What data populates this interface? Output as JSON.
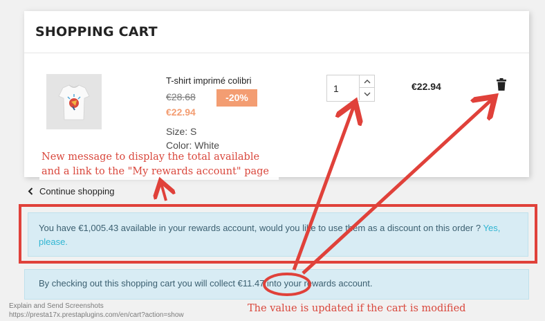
{
  "cart": {
    "title": "SHOPPING CART",
    "item": {
      "name": "T-shirt imprimé colibri",
      "old_price": "€28.68",
      "discount": "-20%",
      "new_price": "€22.94",
      "size": "Size: S",
      "color": "Color: White",
      "quantity": "1",
      "line_total": "€22.94"
    }
  },
  "continue_shopping": "Continue shopping",
  "rewards": {
    "available_text": "You have €1,005.43 available in your rewards account, would you like to use them as a discount on this order ?",
    "use_link": "Yes, please.",
    "earn_prefix": "By checking out this shopping cart you will collect",
    "earn_amount": "€11.47",
    "earn_suffix": "into your rewards account."
  },
  "annotations": {
    "note_1": "New message to display the total available and a link to the \"My rewards account\" page",
    "note_2": "The value is updated if the cart is modified"
  },
  "watermark": {
    "line1": "Explain and Send Screenshots",
    "line2": "https://presta17x.prestaplugins.com/en/cart?action=show"
  },
  "colors": {
    "accent": "#2fb5d2",
    "discount": "#f39d72",
    "annotation": "#e0413a",
    "info_bg": "#d8ecf4"
  },
  "icons": [
    "chevron-up-icon",
    "chevron-down-icon",
    "trash-icon",
    "chevron-left-icon",
    "tshirt-icon"
  ]
}
